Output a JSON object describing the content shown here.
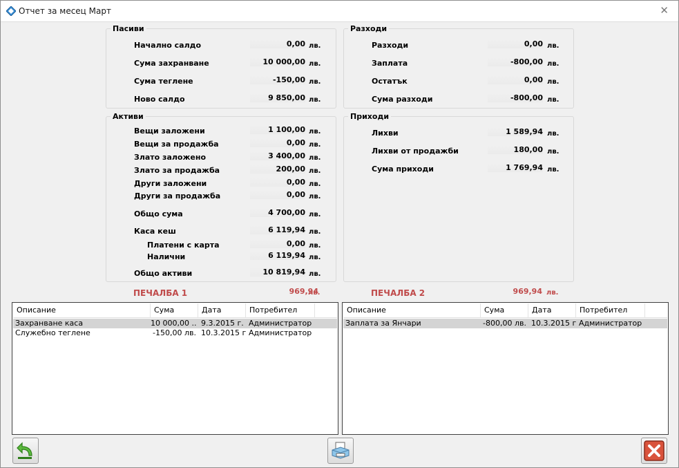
{
  "window": {
    "title": "Отчет за месец Март"
  },
  "pasivi": {
    "title": "Пасиви",
    "rows": [
      {
        "label": "Начално салдо",
        "value": "0,00",
        "cur": "лв."
      },
      {
        "label": "Сума захранване",
        "value": "10 000,00",
        "cur": "лв."
      },
      {
        "label": "Сума теглене",
        "value": "-150,00",
        "cur": "лв."
      },
      {
        "label": "Ново салдо",
        "value": "9 850,00",
        "cur": "лв."
      }
    ]
  },
  "razhodi": {
    "title": "Разходи",
    "rows": [
      {
        "label": "Разходи",
        "value": "0,00",
        "cur": "лв."
      },
      {
        "label": "Заплата",
        "value": "-800,00",
        "cur": "лв."
      },
      {
        "label": "Остатък",
        "value": "0,00",
        "cur": "лв."
      },
      {
        "label": "Сума разходи",
        "value": "-800,00",
        "cur": "лв."
      }
    ]
  },
  "aktivi": {
    "title": "Активи",
    "rows": [
      {
        "label": "Вещи заложени",
        "value": "1 100,00",
        "cur": "лв."
      },
      {
        "label": "Вещи за продажба",
        "value": "0,00",
        "cur": "лв."
      },
      {
        "label": "Злато заложено",
        "value": "3 400,00",
        "cur": "лв."
      },
      {
        "label": "Злато за продажба",
        "value": "200,00",
        "cur": "лв."
      },
      {
        "label": "Други заложени",
        "value": "0,00",
        "cur": "лв."
      },
      {
        "label": "Други за продажба",
        "value": "0,00",
        "cur": "лв."
      },
      {
        "label": "Общо сума",
        "value": "4 700,00",
        "cur": "лв."
      },
      {
        "label": "Каса кеш",
        "value": "6 119,94",
        "cur": "лв."
      },
      {
        "label": "Платени с карта",
        "value": "0,00",
        "cur": "лв."
      },
      {
        "label": "Налични",
        "value": "6 119,94",
        "cur": "лв."
      },
      {
        "label": "Общо активи",
        "value": "10 819,94",
        "cur": "лв."
      }
    ]
  },
  "prihodi": {
    "title": "Приходи",
    "rows": [
      {
        "label": "Лихви",
        "value": "1 589,94",
        "cur": "лв."
      },
      {
        "label": "Лихви от продажби",
        "value": "180,00",
        "cur": "лв."
      },
      {
        "label": "Сума приходи",
        "value": "1 769,94",
        "cur": "лв."
      }
    ]
  },
  "profit1": {
    "label": "ПЕЧАЛБА 1",
    "value": "969,94",
    "cur": "лв."
  },
  "profit2": {
    "label": "ПЕЧАЛБА 2",
    "value": "969,94",
    "cur": "лв."
  },
  "grid_left": {
    "columns": [
      "Описание",
      "Сума",
      "Дата",
      "Потребител"
    ],
    "rows": [
      [
        "Захранване каса",
        "10 000,00 ...",
        "9.3.2015 г.",
        "Администратор"
      ],
      [
        "Служебно теглене",
        "-150,00 лв.",
        "10.3.2015 г.",
        "Администратор"
      ]
    ]
  },
  "grid_right": {
    "columns": [
      "Описание",
      "Сума",
      "Дата",
      "Потребител"
    ],
    "rows": [
      [
        "Заплата за Янчари",
        "-800,00 лв.",
        "10.3.2015 г.",
        "Администратор"
      ]
    ]
  },
  "icons": {
    "app": "diamond-icon",
    "back": "back-arrow-icon",
    "print": "printer-icon",
    "close": "close-icon"
  },
  "colors": {
    "profit": "#c04b4b",
    "selected_row": "#d4d4d4"
  }
}
